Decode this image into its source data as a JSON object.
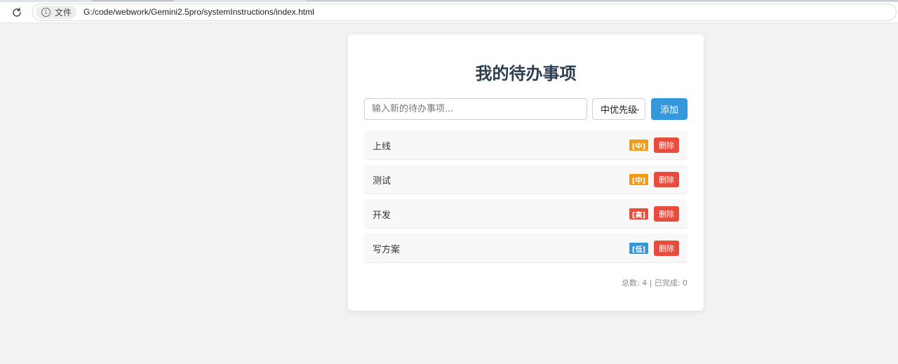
{
  "browser": {
    "chip_label": "文件",
    "url": "G:/code/webwork/Gemini2.5pro/systemInstructions/index.html"
  },
  "app": {
    "title": "我的待办事项",
    "input_placeholder": "输入新的待办事项...",
    "input_value": "",
    "priority_selected": "中优先级",
    "add_label": "添加"
  },
  "todos": [
    {
      "text": "上线",
      "priority": "[中]",
      "priority_color": "#f39c12",
      "delete_label": "删除"
    },
    {
      "text": "测试",
      "priority": "[中]",
      "priority_color": "#f39c12",
      "delete_label": "删除"
    },
    {
      "text": "开发",
      "priority": "[高]",
      "priority_color": "#e74c3c",
      "delete_label": "删除"
    },
    {
      "text": "写方案",
      "priority": "[低]",
      "priority_color": "#3498db",
      "delete_label": "删除"
    }
  ],
  "stats": {
    "text": "总数: 4 | 已完成: 0"
  },
  "colors": {
    "title": "#2c3e50",
    "add_button": "#3498db",
    "delete_button": "#e74c3c"
  }
}
